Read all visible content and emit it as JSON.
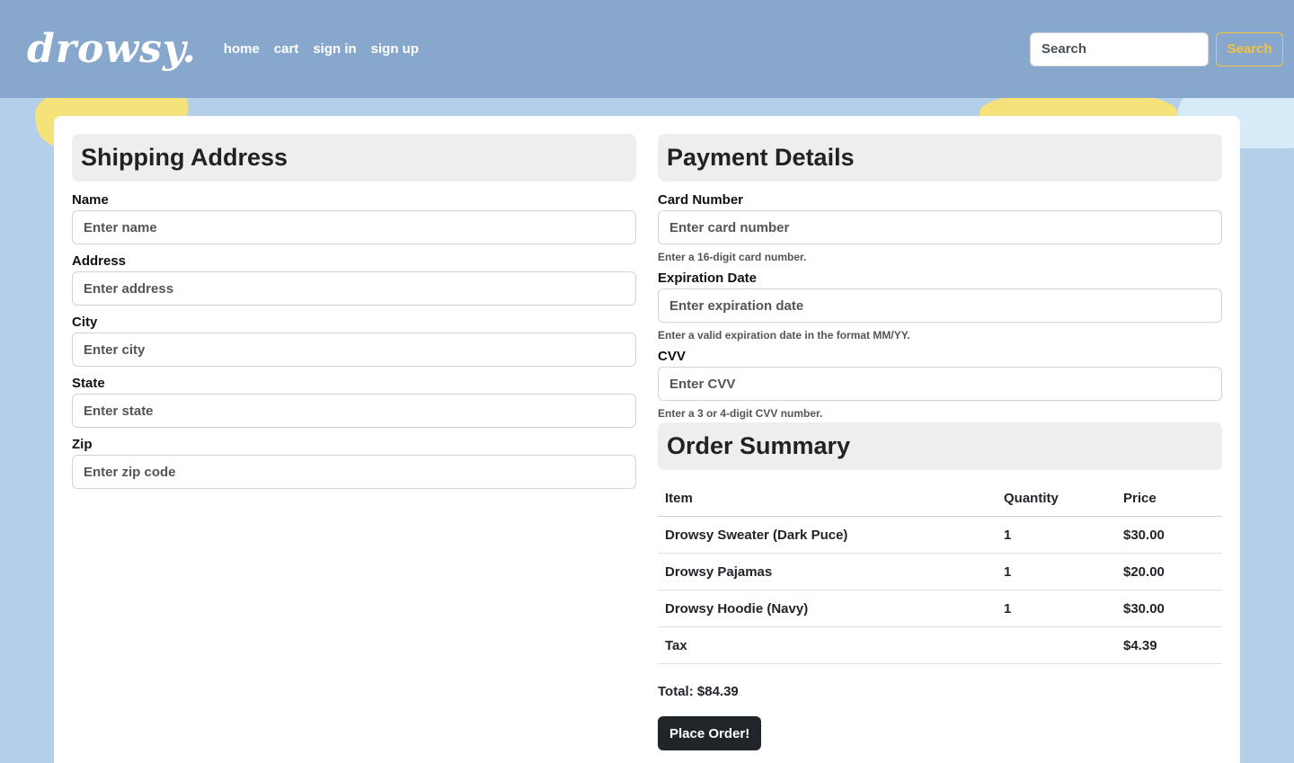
{
  "nav": {
    "brand": "drowsy.",
    "links": [
      "home",
      "cart",
      "sign in",
      "sign up"
    ],
    "search_placeholder": "Search",
    "search_button": "Search"
  },
  "shipping": {
    "title": "Shipping Address",
    "fields": [
      {
        "label": "Name",
        "placeholder": "Enter name"
      },
      {
        "label": "Address",
        "placeholder": "Enter address"
      },
      {
        "label": "City",
        "placeholder": "Enter city"
      },
      {
        "label": "State",
        "placeholder": "Enter state"
      },
      {
        "label": "Zip",
        "placeholder": "Enter zip code"
      }
    ]
  },
  "payment": {
    "title": "Payment Details",
    "fields": [
      {
        "label": "Card Number",
        "placeholder": "Enter card number",
        "help": "Enter a 16-digit card number."
      },
      {
        "label": "Expiration Date",
        "placeholder": "Enter expiration date",
        "help": "Enter a valid expiration date in the format MM/YY."
      },
      {
        "label": "CVV",
        "placeholder": "Enter CVV",
        "help": "Enter a 3 or 4-digit CVV number."
      }
    ]
  },
  "summary": {
    "title": "Order Summary",
    "headers": [
      "Item",
      "Quantity",
      "Price"
    ],
    "rows": [
      [
        "Drowsy Sweater (Dark Puce)",
        "1",
        "$30.00"
      ],
      [
        "Drowsy Pajamas",
        "1",
        "$20.00"
      ],
      [
        "Drowsy Hoodie (Navy)",
        "1",
        "$30.00"
      ],
      [
        "Tax",
        "",
        "$4.39"
      ]
    ],
    "total": "Total: $84.39",
    "button": "Place Order!"
  },
  "colors": {
    "navbar": "#87a7cd",
    "background": "#b3cfe9",
    "accent": "#f5c242",
    "button_dark": "#212529"
  }
}
